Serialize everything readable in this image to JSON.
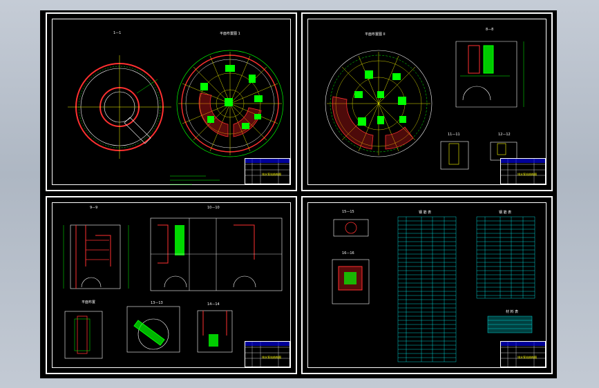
{
  "colors": {
    "background": "#aeb7c3",
    "drawing_area": "#000000",
    "frame": "#ffffff",
    "accent_green": "#00ff00",
    "accent_yellow": "#ffff00",
    "accent_red": "#ff0000",
    "accent_cyan": "#00ffff"
  },
  "sheets": [
    {
      "id": "sheet-1",
      "labels": {
        "view_a": "1—1",
        "view_b": "平面布置图 1"
      },
      "title_block": {
        "name": "排水泵站结构图"
      }
    },
    {
      "id": "sheet-2",
      "labels": {
        "view_a": "平面布置图 II",
        "view_b": "8—8",
        "view_c": "11—11",
        "view_d": "12—12"
      },
      "title_block": {
        "name": "排水泵站结构图"
      }
    },
    {
      "id": "sheet-3",
      "labels": {
        "view_a": "9—9",
        "view_b": "10—10",
        "view_c": "平面布置",
        "view_d": "13—13",
        "view_e": "14—14"
      },
      "title_block": {
        "name": "排水泵站结构图"
      }
    },
    {
      "id": "sheet-4",
      "labels": {
        "view_a": "15—15",
        "view_b": "16—16",
        "table_a": "钢 筋 表",
        "table_b": "钢 筋 表",
        "table_c": "材 料 表"
      },
      "title_block": {
        "name": "排水泵站结构图"
      }
    }
  ]
}
